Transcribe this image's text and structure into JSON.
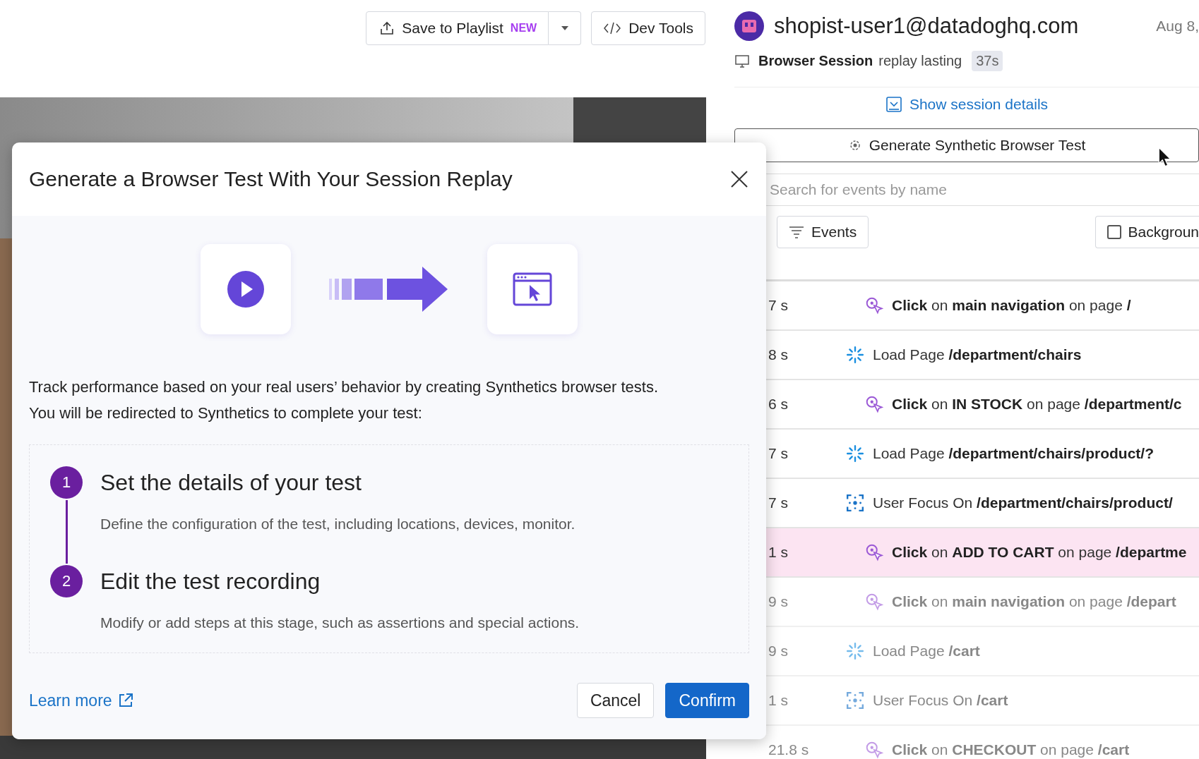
{
  "toolbar": {
    "save_button": {
      "label": "Save to Playlist",
      "badge": "NEW"
    },
    "dev_tools_button": {
      "label": "Dev Tools"
    }
  },
  "session": {
    "user": "shopist-user1@datadoghq.com",
    "date": "Aug 8,",
    "type": "Browser Session",
    "description": "replay lasting",
    "duration": "37s",
    "details_link": "Show session details"
  },
  "generate_button": {
    "label": "Generate Synthetic Browser Test"
  },
  "search": {
    "placeholder": "Search for events by name"
  },
  "filters": {
    "events_button": "Events",
    "background_checkbox": {
      "label": "Backgroun",
      "checked": false
    }
  },
  "events": [
    {
      "time": "7 s",
      "kind": "click",
      "text": "**Click** on **main navigation** on page **/**",
      "selected": false,
      "dimmed": false
    },
    {
      "time": "8 s",
      "kind": "load",
      "text": "Load Page **/department/chairs**",
      "selected": false,
      "dimmed": false
    },
    {
      "time": "6 s",
      "kind": "click",
      "text": "**Click** on **IN STOCK** on page **/department/c**",
      "selected": false,
      "dimmed": false
    },
    {
      "time": "7 s",
      "kind": "load",
      "text": "Load Page **/department/chairs/product/?**",
      "selected": false,
      "dimmed": false
    },
    {
      "time": "7 s",
      "kind": "focus",
      "text": "User Focus On **/department/chairs/product/**",
      "selected": false,
      "dimmed": false
    },
    {
      "time": "1 s",
      "kind": "click",
      "text": "**Click** on **ADD TO CART** on page **/departme**",
      "selected": true,
      "dimmed": false
    },
    {
      "time": "9 s",
      "kind": "click",
      "text": "**Click** on **main navigation** on page **/depart**",
      "selected": false,
      "dimmed": true
    },
    {
      "time": "9 s",
      "kind": "load",
      "text": "Load Page **/cart**",
      "selected": false,
      "dimmed": true
    },
    {
      "time": "1 s",
      "kind": "focus",
      "text": "User Focus On **/cart**",
      "selected": false,
      "dimmed": true
    },
    {
      "time": "21.8 s",
      "kind": "click",
      "text": "**Click** on **CHECKOUT** on page **/cart**",
      "selected": false,
      "dimmed": true
    }
  ],
  "modal": {
    "title": "Generate a Browser Test With Your Session Replay",
    "description": "Track performance based on your real users’ behavior by creating Synthetics browser tests. You will be redirected to Synthetics to complete your test:",
    "steps": [
      {
        "number": "1",
        "title": "Set the details of your test",
        "description": "Define the configuration of the test, including locations, devices, monitor."
      },
      {
        "number": "2",
        "title": "Edit the test recording",
        "description": "Modify or add steps at this stage, such as assertions and special actions."
      }
    ],
    "learn_more": "Learn more",
    "cancel": "Cancel",
    "confirm": "Confirm"
  }
}
